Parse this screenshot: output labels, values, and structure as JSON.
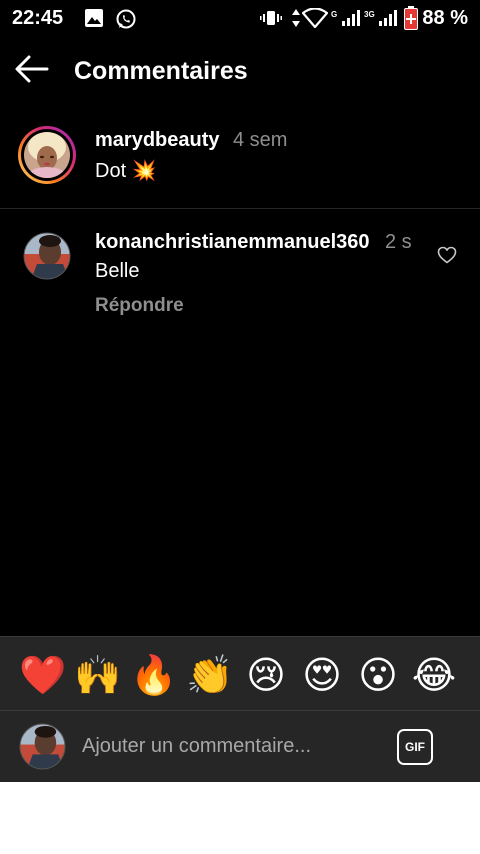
{
  "status_bar": {
    "time": "22:45",
    "battery": "88 %",
    "network_g": "G",
    "network_3g": "3G",
    "icons": [
      "image-icon",
      "whatsapp-icon",
      "vibrate-icon",
      "data-arrows-icon",
      "wifi-icon",
      "signal-icon",
      "battery-charging-icon"
    ]
  },
  "header": {
    "title": "Commentaires"
  },
  "comments": [
    {
      "username": "marydbeauty",
      "time": "4 sem",
      "text": "Dot 💥",
      "has_story_ring": true
    },
    {
      "username": "konanchristianemmanuel360",
      "time": "2 s",
      "text": "Belle",
      "reply_label": "Répondre"
    }
  ],
  "emoji_bar": {
    "emojis": [
      "❤️",
      "🙌",
      "🔥",
      "👏",
      "😢",
      "😍",
      "😮",
      "😂"
    ]
  },
  "input": {
    "placeholder": "Ajouter un commentaire...",
    "gif_label": "GIF"
  },
  "colors": {
    "background": "#000000",
    "secondary_text": "#8e8e8e",
    "input_bar": "#262626",
    "story_ring_start": "#feda75",
    "story_ring_end": "#d62976"
  }
}
